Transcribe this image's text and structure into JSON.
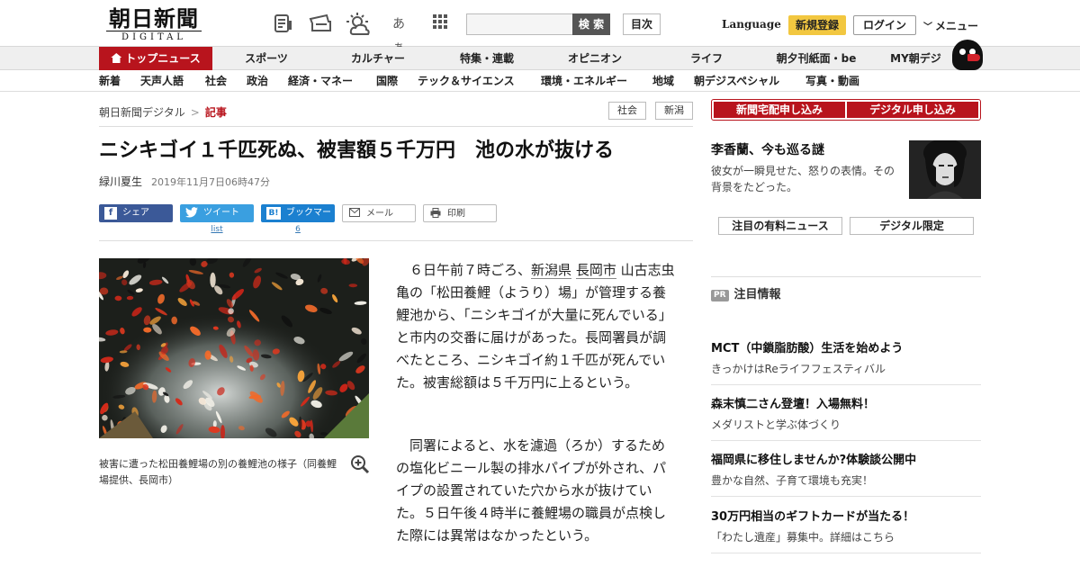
{
  "header": {
    "logo_main": "朝日新聞",
    "logo_sub": "DIGITAL",
    "search_button": "検 索",
    "toc_button": "目次",
    "language": "Language",
    "register": "新規登録",
    "login": "ログイン",
    "menu": "メニュー",
    "kana_icon_text": "あぁ"
  },
  "main_nav": [
    "トップニュース",
    "スポーツ",
    "カルチャー",
    "特集・連載",
    "オピニオン",
    "ライフ",
    "朝夕刊紙面・be",
    "MY朝デジ"
  ],
  "sub_nav": [
    "新着",
    "天声人語",
    "社会",
    "政治",
    "経済・マネー",
    "国際",
    "テック＆サイエンス",
    "環境・エネルギー",
    "地域",
    "朝デジスペシャル",
    "写真・動画"
  ],
  "breadcrumb": {
    "home": "朝日新聞デジタル",
    "separator": ">",
    "current": "記事"
  },
  "tags": [
    "社会",
    "新潟"
  ],
  "article": {
    "headline": "ニシキゴイ１千匹死ぬ、被害額５千万円　池の水が抜ける",
    "author": "緑川夏生",
    "date": "2019年11月7日06時47分",
    "caption": "被害に遭った松田養鯉場の別の養鯉池の様子（同養鯉場提供、長岡市）",
    "para1_pre": "６日午前７時ごろ、",
    "para1_link1": "新潟県",
    "para1_link2": "長岡市",
    "para1_post": "山古志虫亀の「松田養鯉（ようり）場」が管理する養鯉池から、「ニシキゴイが大量に死んでいる」と市内の交番に届けがあった。長岡署員が調べたところ、ニシキゴイ約１千匹が死んでいた。被害総額は５千万円に上るという。",
    "para2": "同署によると、水を濾過（ろか）するための塩化ビニール製の排水パイプが外され、パイプの設置されていた穴から水が抜けていた。５日午後４時半に養鯉場の職員が点検した際には異常はなかったという。"
  },
  "share": {
    "facebook": "シェア",
    "twitter": "ツイート",
    "hatena": "ブックマーク",
    "hatena_icon": "B!",
    "mail": "メール",
    "print": "印刷",
    "twitter_count": "list",
    "hatena_count": "6"
  },
  "sidebar": {
    "subscribe_paper": "新聞宅配申し込み",
    "subscribe_digital": "デジタル申し込み",
    "feature_title": "李香蘭、今も巡る謎",
    "feature_desc": "彼女が一瞬見せた、怒りの表情。その背景をたどった。",
    "tab_paid": "注目の有料ニュース",
    "tab_digital": "デジタル限定",
    "pr_label": "PR",
    "pr_heading": "注目情報",
    "pr_items": [
      {
        "title": "MCT（中鎖脂肪酸）生活を始めよう",
        "desc": "きっかけはReライフフェスティバル"
      },
      {
        "title": "森末慎二さん登壇！入場無料！",
        "desc": "メダリストと学ぶ体づくり"
      },
      {
        "title": "福岡県に移住しませんか?体験談公開中",
        "desc": "豊かな自然、子育て環境も充実！"
      },
      {
        "title": "30万円相当のギフトカードが当たる！",
        "desc": "「わたし遺産」募集中。詳細はこちら"
      }
    ]
  },
  "colors": {
    "brand_red": "#b8141d",
    "register_yellow": "#f2c740",
    "facebook": "#3b5998",
    "twitter": "#3a9fe0",
    "hatena": "#1b80d0"
  }
}
